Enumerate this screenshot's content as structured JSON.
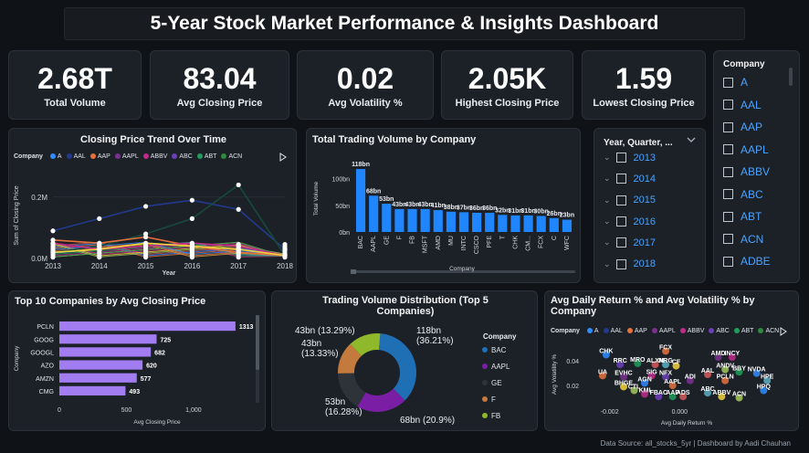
{
  "title": "5-Year Stock Market Performance & Insights Dashboard",
  "kpis": [
    {
      "value": "2.68T",
      "label": "Total Volume"
    },
    {
      "value": "83.04",
      "label": "Avg Closing Price"
    },
    {
      "value": "0.02",
      "label": "Avg Volatility %"
    },
    {
      "value": "2.05K",
      "label": "Highest Closing Price"
    },
    {
      "value": "1.59",
      "label": "Lowest Closing Price"
    }
  ],
  "company_slicer": {
    "title": "Company",
    "items": [
      "A",
      "AAL",
      "AAP",
      "AAPL",
      "ABBV",
      "ABC",
      "ABT",
      "ACN",
      "ADBE"
    ]
  },
  "year_slicer": {
    "title": "Year, Quarter, ...",
    "items": [
      "2013",
      "2014",
      "2015",
      "2016",
      "2017",
      "2018"
    ]
  },
  "legend": {
    "label": "Company",
    "items": [
      {
        "name": "A",
        "color": "#2f8cff"
      },
      {
        "name": "AAL",
        "color": "#233a8c"
      },
      {
        "name": "AAP",
        "color": "#e8713a"
      },
      {
        "name": "AAPL",
        "color": "#7b2f91"
      },
      {
        "name": "ABBV",
        "color": "#c02a8a"
      },
      {
        "name": "ABC",
        "color": "#6b3fb8"
      },
      {
        "name": "ABT",
        "color": "#1f9e5a"
      },
      {
        "name": "ACN",
        "color": "#2c8b3c"
      }
    ]
  },
  "colors": {
    "bar_blue": "#1f86ff",
    "bar_purple": "#a27df2",
    "bg": "#0f1216",
    "panel": "#1c2128",
    "slicer_text": "#4aa3ff"
  },
  "chart_data": [
    {
      "id": "trend",
      "type": "line",
      "title": "Closing Price Trend Over Time",
      "xlabel": "Year",
      "ylabel": "Sum of Closing Price",
      "x": [
        2013,
        2014,
        2015,
        2016,
        2017,
        2018
      ],
      "y_ticks": [
        "0.0M",
        "0.2M"
      ],
      "series": [
        {
          "name": "AAL",
          "color": "#233a8c",
          "values": [
            0.09,
            0.13,
            0.17,
            0.19,
            0.16,
            0.03
          ]
        },
        {
          "name": "ACN",
          "color": "#184a3c",
          "values": [
            0.02,
            0.04,
            0.08,
            0.13,
            0.24,
            0.01
          ]
        },
        {
          "name": "AAP",
          "color": "#e8713a",
          "values": [
            0.06,
            0.05,
            0.07,
            0.04,
            0.02,
            0.01
          ]
        },
        {
          "name": "ABBV",
          "color": "#c02a8a",
          "values": [
            0.05,
            0.03,
            0.04,
            0.05,
            0.04,
            0.01
          ]
        },
        {
          "name": "A",
          "color": "#f2d43c",
          "values": [
            0.02,
            0.03,
            0.05,
            0.04,
            0.03,
            0.01
          ]
        }
      ],
      "ylim": [
        0,
        0.28
      ]
    },
    {
      "id": "volume",
      "type": "bar",
      "title": "Total Trading Volume by Company",
      "xlabel": "Company",
      "ylabel": "Total Volume",
      "y_ticks": [
        "0bn",
        "50bn",
        "100bn"
      ],
      "categories": [
        "BAC",
        "AAPL",
        "GE",
        "F",
        "FB",
        "MSFT",
        "AMD",
        "MU",
        "INTC",
        "CSCO",
        "PFE",
        "T",
        "CHK",
        "CM...",
        "FCX",
        "C",
        "WFC"
      ],
      "values": [
        118,
        68,
        53,
        43,
        43,
        43,
        41,
        38,
        37,
        36,
        36,
        32,
        31,
        31,
        30,
        26,
        23
      ],
      "labels": [
        "118bn",
        "68bn",
        "53bn",
        "43bn",
        "43bn",
        "43bn",
        "41bn",
        "38bn",
        "37bn",
        "36bn",
        "36bn",
        "32bn",
        "31bn",
        "31bn",
        "30bn",
        "26bn",
        "23bn"
      ],
      "ylim": [
        0,
        125
      ]
    },
    {
      "id": "top10",
      "type": "bar",
      "orientation": "horizontal",
      "title": "Top 10 Companies by Avg Closing Price",
      "xlabel": "Avg Closing Price",
      "ylabel": "Company",
      "x_ticks": [
        "0",
        "500",
        "1,000"
      ],
      "categories": [
        "PCLN",
        "GOOG",
        "GOOGL",
        "AZO",
        "AMZN",
        "CMG"
      ],
      "values": [
        1313,
        725,
        682,
        620,
        577,
        493
      ],
      "xlim": [
        0,
        1450
      ]
    },
    {
      "id": "donut",
      "type": "pie",
      "title": "Trading Volume Distribution (Top 5 Companies)",
      "legend_title": "Company",
      "categories": [
        "BAC",
        "AAPL",
        "GE",
        "F",
        "FB"
      ],
      "values": [
        36.21,
        20.9,
        16.28,
        13.33,
        13.29
      ],
      "colors": [
        "#1f6fb5",
        "#7a1fa5",
        "#2e3239",
        "#c47a3c",
        "#8fb82a"
      ],
      "labels": [
        "118bn\n(36.21%)",
        "68bn (20.9%)",
        "53bn\n(16.28%)",
        "43bn\n(13.33%)",
        "43bn (13.29%)"
      ]
    },
    {
      "id": "scatter",
      "type": "scatter",
      "title": "Avg Daily Return % and Avg Volatility % by Company",
      "xlabel": "Avg Daily Return %",
      "ylabel": "Avg Volatility %",
      "x_ticks": [
        "-0.002",
        "0.000"
      ],
      "y_ticks": [
        "0.02",
        "0.04"
      ],
      "points": [
        {
          "label": "CHK",
          "x": -0.0021,
          "y": 0.045
        },
        {
          "label": "FCX",
          "x": -0.0004,
          "y": 0.048
        },
        {
          "label": "AMD",
          "x": 0.0011,
          "y": 0.043
        },
        {
          "label": "INCY",
          "x": 0.0015,
          "y": 0.043
        },
        {
          "label": "RRC",
          "x": -0.0017,
          "y": 0.037
        },
        {
          "label": "MRO",
          "x": -0.0012,
          "y": 0.038
        },
        {
          "label": "ALXN",
          "x": -0.0007,
          "y": 0.037
        },
        {
          "label": "NRG",
          "x": -0.0004,
          "y": 0.037
        },
        {
          "label": "CF",
          "x": -0.0001,
          "y": 0.036
        },
        {
          "label": "ANDV",
          "x": 0.0013,
          "y": 0.033
        },
        {
          "label": "NVDA",
          "x": 0.0022,
          "y": 0.03
        },
        {
          "label": "UA",
          "x": -0.0022,
          "y": 0.028
        },
        {
          "label": "EVHC",
          "x": -0.0016,
          "y": 0.027
        },
        {
          "label": "SIG",
          "x": -0.0008,
          "y": 0.028
        },
        {
          "label": "NFX",
          "x": -0.0004,
          "y": 0.027
        },
        {
          "label": "BBY",
          "x": 0.0017,
          "y": 0.031
        },
        {
          "label": "AAL",
          "x": 0.0008,
          "y": 0.029
        },
        {
          "label": "HPE",
          "x": 0.0025,
          "y": 0.024
        },
        {
          "label": "BHGE",
          "x": -0.0016,
          "y": 0.019
        },
        {
          "label": "CTL",
          "x": -0.0013,
          "y": 0.016
        },
        {
          "label": "AGN",
          "x": -0.001,
          "y": 0.022
        },
        {
          "label": "AAPL",
          "x": -0.0002,
          "y": 0.02
        },
        {
          "label": "ADI",
          "x": 0.0003,
          "y": 0.024
        },
        {
          "label": "KMI",
          "x": -0.001,
          "y": 0.013
        },
        {
          "label": "FBAC",
          "x": -0.0006,
          "y": 0.011
        },
        {
          "label": "AAP",
          "x": -0.0002,
          "y": 0.011
        },
        {
          "label": "ADS",
          "x": 0.0001,
          "y": 0.011
        },
        {
          "label": "ABC",
          "x": 0.0008,
          "y": 0.014
        },
        {
          "label": "ABBV",
          "x": 0.0012,
          "y": 0.011
        },
        {
          "label": "ACN",
          "x": 0.0017,
          "y": 0.01
        },
        {
          "label": "HPQ",
          "x": 0.0024,
          "y": 0.016
        },
        {
          "label": "PCLN",
          "x": 0.0013,
          "y": 0.024
        }
      ],
      "xlim": [
        -0.0028,
        0.0032
      ],
      "ylim": [
        0.003,
        0.055
      ]
    }
  ],
  "footer": "Data Source: all_stocks_5yr | Dashboard by Aadi Chauhan"
}
